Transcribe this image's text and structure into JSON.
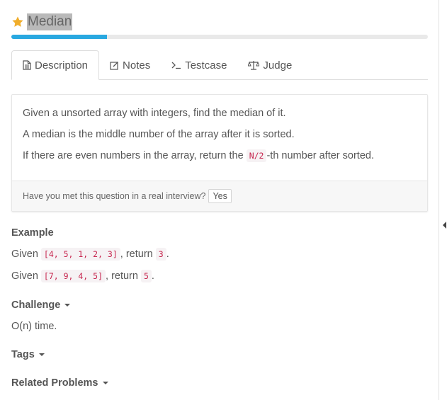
{
  "problem": {
    "title": "Median",
    "progress_fraction": 0.23
  },
  "tabs": [
    {
      "label": "Description",
      "icon": "document-icon"
    },
    {
      "label": "Notes",
      "icon": "notes-icon"
    },
    {
      "label": "Testcase",
      "icon": "terminal-icon"
    },
    {
      "label": "Judge",
      "icon": "scale-icon"
    }
  ],
  "description": {
    "line1": "Given a unsorted array with integers, find the median of it.",
    "line2": "A median is the middle number of the array after it is sorted.",
    "line3_prefix": "If there are even numbers in the array, return the ",
    "line3_code": "N/2",
    "line3_suffix": "-th number after sorted."
  },
  "interview": {
    "question": "Have you met this question in a real interview?",
    "yes_label": "Yes"
  },
  "example": {
    "heading": "Example",
    "items": [
      {
        "given": "Given ",
        "input": "[4, 5, 1, 2, 3]",
        "mid": ", return ",
        "output": "3",
        "end": "."
      },
      {
        "given": "Given ",
        "input": "[7, 9, 4, 5]",
        "mid": ", return ",
        "output": "5",
        "end": "."
      }
    ]
  },
  "challenge": {
    "heading": "Challenge",
    "text": "O(n) time."
  },
  "tags": {
    "heading": "Tags"
  },
  "related": {
    "heading": "Related Problems"
  },
  "colors": {
    "accent": "#29a8e0",
    "code_text": "#c7254e",
    "star": "#f0ad2a"
  }
}
